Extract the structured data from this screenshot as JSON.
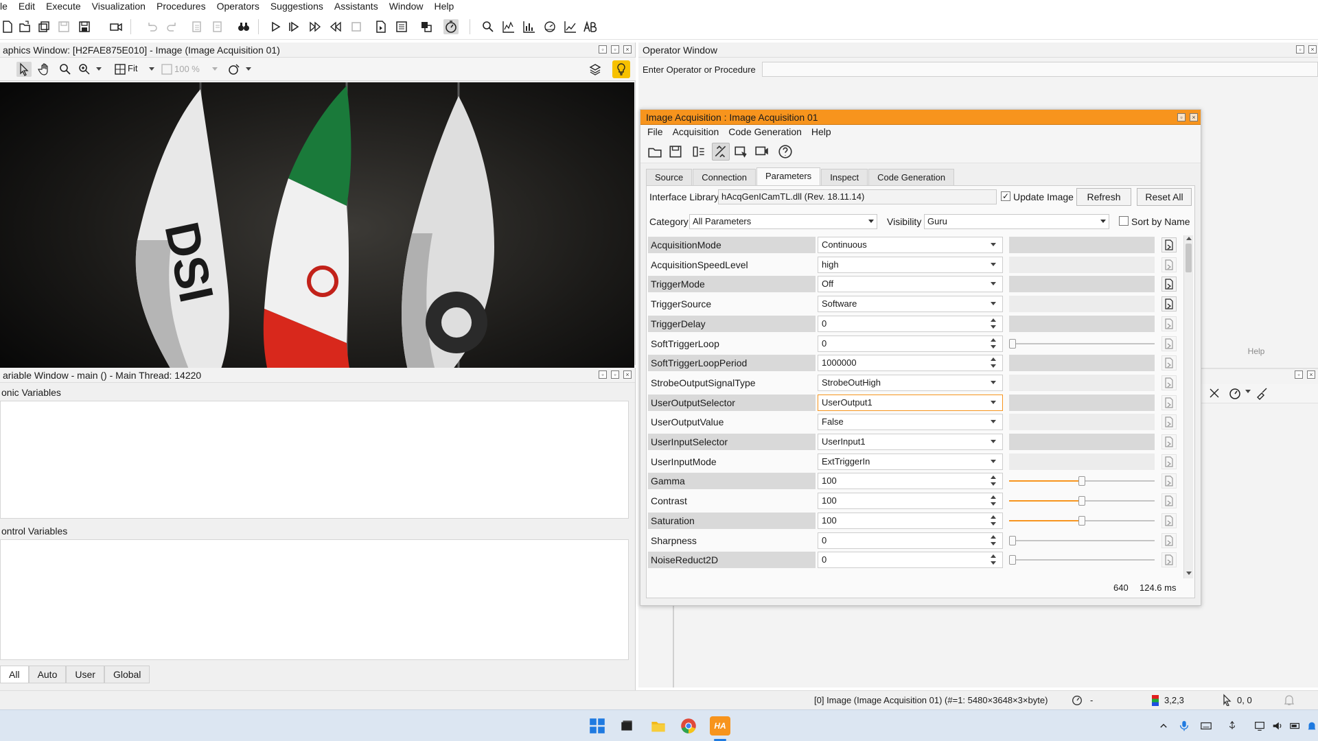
{
  "menubar": {
    "items": [
      "le",
      "Edit",
      "Execute",
      "Visualization",
      "Procedures",
      "Operators",
      "Suggestions",
      "Assistants",
      "Window",
      "Help"
    ]
  },
  "toolbar": {
    "icons": [
      "new-file-icon",
      "open-file-icon",
      "open-multiple-icon",
      "save-icon",
      "save-all-icon",
      "camera-icon",
      "undo-icon",
      "redo-icon",
      "copy-icon",
      "paste-icon",
      "binoculars-icon",
      "run-icon",
      "step-icon",
      "step-over-icon",
      "step-back-icon",
      "stop-icon",
      "insert-icon",
      "procedure-icon",
      "graphics-icon",
      "profiler-icon",
      "zoom-icon",
      "histogram-icon",
      "bar-chart-icon",
      "gauge-icon",
      "line-chart-icon",
      "text-icon"
    ]
  },
  "graphics_window": {
    "title": "aphics Window: [H2FAE875E010] - Image (Image Acquisition 01)",
    "zoom_mode": "Fit",
    "zoom_percent": "100 %"
  },
  "variable_window": {
    "title": "ariable Window - main () - Main Thread: 14220",
    "iconic_label": "onic Variables",
    "control_label": "ontrol Variables",
    "tabs": [
      "All",
      "Auto",
      "User",
      "Global"
    ]
  },
  "operator_window": {
    "title": "Operator Window",
    "entry_label": "Enter Operator or Procedure",
    "help_label": "Help"
  },
  "image_acquisition": {
    "title": "Image Acquisition : Image Acquisition 01",
    "menu": [
      "File",
      "Acquisition",
      "Code Generation",
      "Help"
    ],
    "tabs": [
      "Source",
      "Connection",
      "Parameters",
      "Inspect",
      "Code Generation"
    ],
    "selected_tab": "Parameters",
    "interface_library_label": "Interface Library",
    "interface_library_value": "hAcqGenICamTL.dll (Rev. 18.11.14)",
    "update_image_label": "Update Image",
    "update_image_checked": true,
    "refresh_label": "Refresh",
    "reset_all_label": "Reset All",
    "category_label": "Category",
    "category_value": "All Parameters",
    "visibility_label": "Visibility",
    "visibility_value": "Guru",
    "sort_label": "Sort by Name",
    "parameters": [
      {
        "name": "AcquisitionMode",
        "value": "Continuous",
        "kind": "dropdown",
        "grey": true
      },
      {
        "name": "AcquisitionSpeedLevel",
        "value": "high",
        "kind": "dropdown",
        "grey": false
      },
      {
        "name": "TriggerMode",
        "value": "Off",
        "kind": "dropdown",
        "grey": true
      },
      {
        "name": "TriggerSource",
        "value": "Software",
        "kind": "dropdown",
        "grey": false
      },
      {
        "name": "TriggerDelay",
        "value": "0",
        "kind": "spin",
        "grey": true
      },
      {
        "name": "SoftTriggerLoop",
        "value": "0",
        "kind": "spin",
        "grey": false,
        "slider": 0
      },
      {
        "name": "SoftTriggerLoopPeriod",
        "value": "1000000",
        "kind": "spin",
        "grey": true
      },
      {
        "name": "StrobeOutputSignalType",
        "value": "StrobeOutHigh",
        "kind": "dropdown",
        "grey": false
      },
      {
        "name": "UserOutputSelector",
        "value": "UserOutput1",
        "kind": "dropdown",
        "grey": true,
        "highlight": true
      },
      {
        "name": "UserOutputValue",
        "value": "False",
        "kind": "dropdown",
        "grey": false
      },
      {
        "name": "UserInputSelector",
        "value": "UserInput1",
        "kind": "dropdown",
        "grey": true
      },
      {
        "name": "UserInputMode",
        "value": "ExtTriggerIn",
        "kind": "dropdown",
        "grey": false
      },
      {
        "name": "Gamma",
        "value": "100",
        "kind": "spin",
        "grey": true,
        "slider": 0.5
      },
      {
        "name": "Contrast",
        "value": "100",
        "kind": "spin",
        "grey": false,
        "slider": 0.5
      },
      {
        "name": "Saturation",
        "value": "100",
        "kind": "spin",
        "grey": true,
        "slider": 0.5
      },
      {
        "name": "Sharpness",
        "value": "0",
        "kind": "spin",
        "grey": false,
        "slider": 0
      },
      {
        "name": "NoiseReduct2D",
        "value": "0",
        "kind": "spin",
        "grey": true,
        "slider": 0
      }
    ],
    "footer_value1": "640",
    "footer_value2": "124.6 ms"
  },
  "statusbar": {
    "image_info": "[0] Image (Image Acquisition 01) (#=1: 5480×3648×3×byte)",
    "dash": "-",
    "pixel_value": "3,2,3",
    "coords": "0, 0"
  },
  "colors": {
    "accent": "#f7941d",
    "canvas": "#0c0c0c",
    "grid_grey": "#d9d9d9"
  }
}
